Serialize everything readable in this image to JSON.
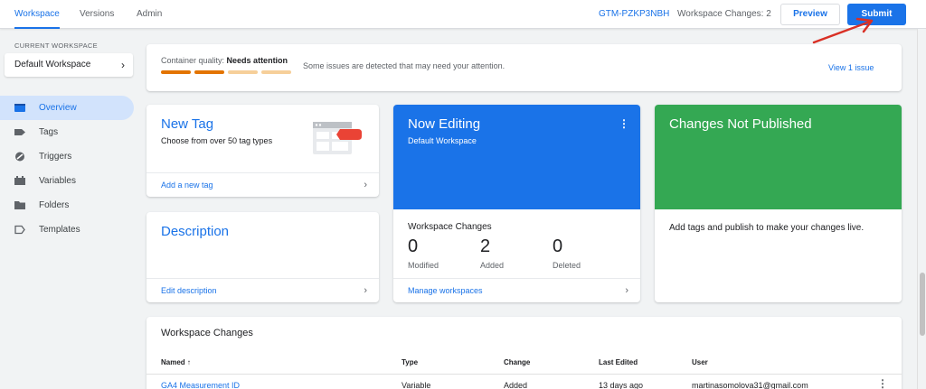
{
  "topbar": {
    "tabs": [
      {
        "label": "Workspace",
        "active": true
      },
      {
        "label": "Versions",
        "active": false
      },
      {
        "label": "Admin",
        "active": false
      }
    ],
    "container_id": "GTM-PZKP3NBH",
    "workspace_changes": "Workspace Changes: 2",
    "preview_label": "Preview",
    "submit_label": "Submit"
  },
  "sidebar": {
    "current_workspace_label": "CURRENT WORKSPACE",
    "workspace_name": "Default Workspace",
    "items": [
      {
        "label": "Overview",
        "icon": "overview-icon",
        "active": true
      },
      {
        "label": "Tags",
        "icon": "tag-icon",
        "active": false
      },
      {
        "label": "Triggers",
        "icon": "trigger-icon",
        "active": false
      },
      {
        "label": "Variables",
        "icon": "variables-icon",
        "active": false
      },
      {
        "label": "Folders",
        "icon": "folder-icon",
        "active": false
      },
      {
        "label": "Templates",
        "icon": "template-icon",
        "active": false
      }
    ]
  },
  "quality": {
    "prefix": "Container quality: ",
    "status": "Needs attention",
    "message": "Some issues are detected that may need your attention.",
    "link": "View 1 issue",
    "bar_colors": [
      "#e37400",
      "#e37400",
      "#f6cf9a",
      "#f6cf9a"
    ]
  },
  "new_tag": {
    "title": "New Tag",
    "subtitle": "Choose from over 50 tag types",
    "link": "Add a new tag"
  },
  "description": {
    "title": "Description",
    "link": "Edit description"
  },
  "now_editing": {
    "title": "Now Editing",
    "subtitle": "Default Workspace",
    "changes_title": "Workspace Changes",
    "stats": [
      {
        "value": "0",
        "label": "Modified"
      },
      {
        "value": "2",
        "label": "Added"
      },
      {
        "value": "0",
        "label": "Deleted"
      }
    ],
    "link": "Manage workspaces"
  },
  "not_published": {
    "title": "Changes Not Published",
    "message": "Add tags and publish to make your changes live."
  },
  "changes_table": {
    "title": "Workspace Changes",
    "columns": [
      "Named ↑",
      "Type",
      "Change",
      "Last Edited",
      "User"
    ],
    "rows": [
      {
        "name": "GA4 Measurement ID",
        "type": "Variable",
        "change": "Added",
        "last_edited": "13 days ago",
        "user": "martinasomolova31@gmail.com"
      }
    ]
  },
  "colors": {
    "accent": "#1a73e8",
    "editing_card": "#1a73e8",
    "not_published_card": "#34a853",
    "annotation_arrow": "#d93025"
  }
}
